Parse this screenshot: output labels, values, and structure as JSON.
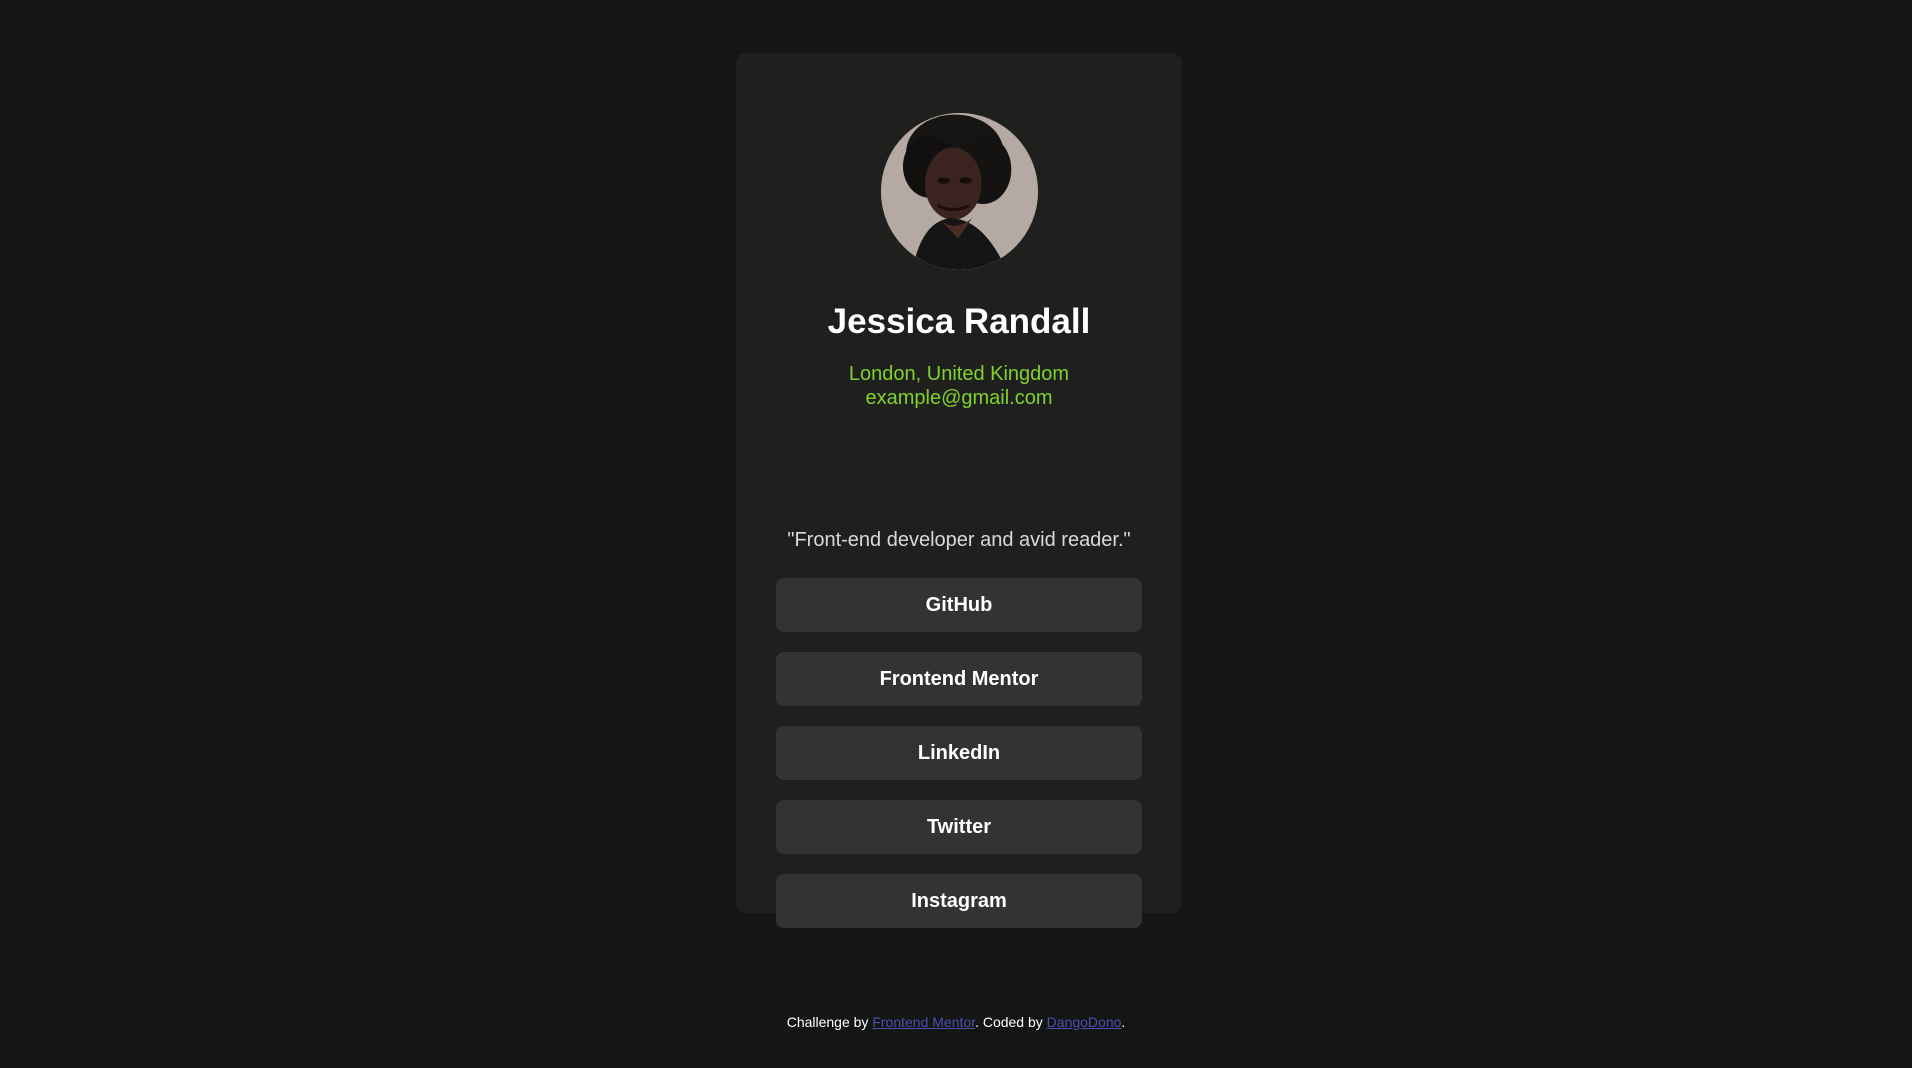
{
  "profile": {
    "name": "Jessica Randall",
    "location": "London, United Kingdom",
    "email": "example@gmail.com",
    "bio": "\"Front-end developer and avid reader.\"",
    "avatar_icon": "profile-photo"
  },
  "links": [
    {
      "label": "GitHub"
    },
    {
      "label": "Frontend Mentor"
    },
    {
      "label": "LinkedIn"
    },
    {
      "label": "Twitter"
    },
    {
      "label": "Instagram"
    }
  ],
  "footer": {
    "prefix": "Challenge by ",
    "challenge_link": "Frontend Mentor",
    "middle": ". Coded by ",
    "author_link": "DangoDono",
    "suffix": "."
  },
  "colors": {
    "page_bg": "#141614",
    "card_bg": "#1f201e",
    "button_bg": "#333432",
    "accent": "#7fd22c",
    "footer_link": "#4b4fae"
  }
}
